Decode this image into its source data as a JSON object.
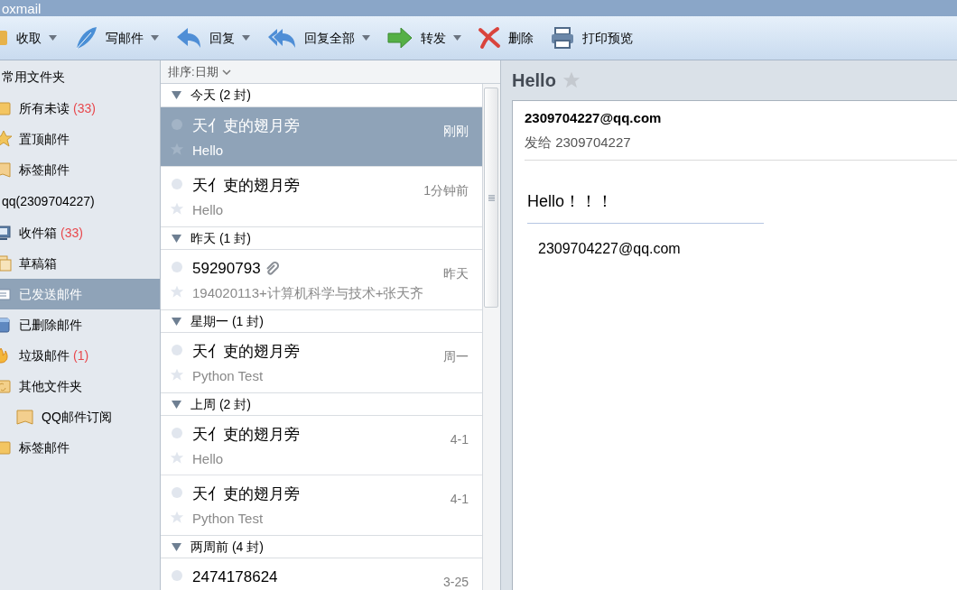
{
  "window": {
    "title": "oxmail"
  },
  "toolbar": [
    {
      "label": "收取",
      "dropdown": true
    },
    {
      "label": "写邮件",
      "dropdown": true
    },
    {
      "label": "回复",
      "dropdown": true
    },
    {
      "label": "回复全部",
      "dropdown": true
    },
    {
      "label": "转发",
      "dropdown": true
    },
    {
      "label": "删除",
      "dropdown": false
    },
    {
      "label": "打印预览",
      "dropdown": false
    }
  ],
  "sidebar": {
    "sections": [
      {
        "title": "常用文件夹",
        "items": [
          {
            "label": "所有未读",
            "count": "(33)",
            "selected": false
          },
          {
            "label": "置顶邮件",
            "selected": false
          },
          {
            "label": "标签邮件",
            "selected": false
          }
        ]
      },
      {
        "title": "qq(2309704227)",
        "items": [
          {
            "label": "收件箱",
            "count": "(33)",
            "selected": false
          },
          {
            "label": "草稿箱",
            "selected": false
          },
          {
            "label": "已发送邮件",
            "selected": true
          },
          {
            "label": "已删除邮件",
            "selected": false
          },
          {
            "label": "垃圾邮件",
            "count": "(1)",
            "selected": false
          },
          {
            "label": "其他文件夹",
            "selected": false,
            "children": [
              {
                "label": "QQ邮件订阅",
                "selected": false
              }
            ]
          },
          {
            "label": "标签邮件",
            "selected": false
          }
        ]
      }
    ]
  },
  "message_list": {
    "sort": "排序:日期",
    "groups": [
      {
        "label": "今天 (2 封)",
        "messages": [
          {
            "sender": "天亻吏的翅月旁",
            "time": "刚刚",
            "subject": "Hello",
            "attachment": false,
            "selected": true
          },
          {
            "sender": "天亻吏的翅月旁",
            "time": "1分钟前",
            "subject": "Hello",
            "attachment": false,
            "selected": false
          }
        ]
      },
      {
        "label": "昨天 (1 封)",
        "messages": [
          {
            "sender": "59290793",
            "time": "昨天",
            "subject": "194020113+计算机科学与技术+张天齐",
            "attachment": true,
            "selected": false
          }
        ]
      },
      {
        "label": "星期一 (1 封)",
        "messages": [
          {
            "sender": "天亻吏的翅月旁",
            "time": "周一",
            "subject": "Python Test",
            "attachment": false,
            "selected": false
          }
        ]
      },
      {
        "label": "上周 (2 封)",
        "messages": [
          {
            "sender": "天亻吏的翅月旁",
            "time": "4-1",
            "subject": "Hello",
            "attachment": false,
            "selected": false
          },
          {
            "sender": "天亻吏的翅月旁",
            "time": "4-1",
            "subject": "Python Test",
            "attachment": false,
            "selected": false
          }
        ]
      },
      {
        "label": "两周前 (4 封)",
        "messages": [
          {
            "sender": "2474178624",
            "time": "3-25",
            "attachment": false,
            "selected": false
          }
        ]
      }
    ]
  },
  "reader": {
    "subject": "Hello",
    "from": "2309704227@qq.com",
    "to": "发给 2309704227",
    "body": "Hello！！！",
    "signature": "2309704227@qq.com"
  }
}
